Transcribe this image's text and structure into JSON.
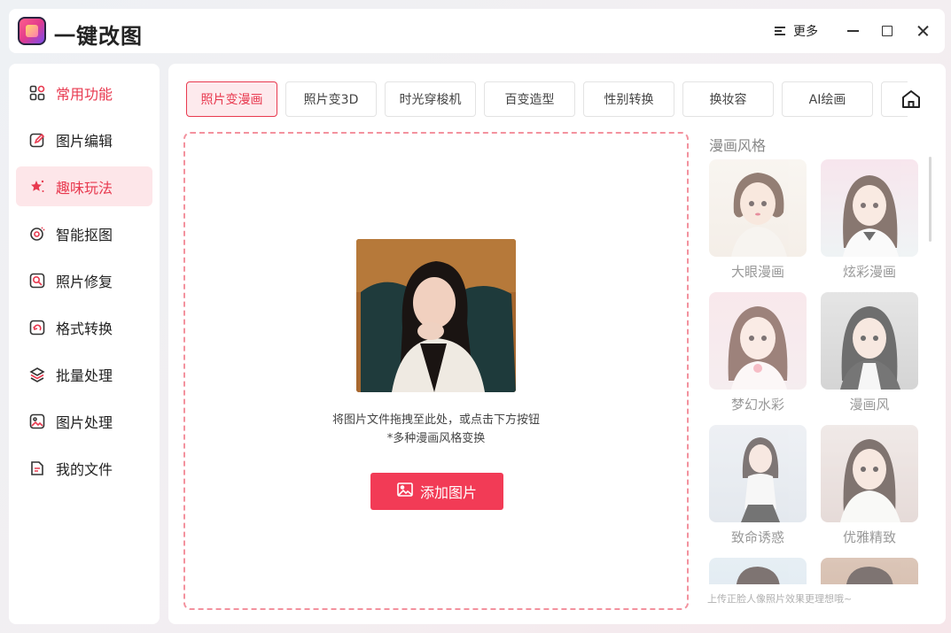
{
  "app": {
    "title": "一键改图"
  },
  "window": {
    "more_label": "更多"
  },
  "sidebar": {
    "items": [
      {
        "label": "常用功能",
        "icon": "grid-icon"
      },
      {
        "label": "图片编辑",
        "icon": "edit-icon"
      },
      {
        "label": "趣味玩法",
        "icon": "star-sparkle-icon"
      },
      {
        "label": "智能抠图",
        "icon": "cutout-icon"
      },
      {
        "label": "照片修复",
        "icon": "repair-icon"
      },
      {
        "label": "格式转换",
        "icon": "convert-icon"
      },
      {
        "label": "批量处理",
        "icon": "layers-icon"
      },
      {
        "label": "图片处理",
        "icon": "image-icon"
      },
      {
        "label": "我的文件",
        "icon": "file-icon"
      }
    ],
    "active_index": 2
  },
  "tabs": {
    "items": [
      "照片变漫画",
      "照片变3D",
      "时光穿梭机",
      "百变造型",
      "性别转换",
      "换妆容",
      "AI绘画",
      ""
    ],
    "active_index": 0
  },
  "upload": {
    "hint_line1": "将图片文件拖拽至此处，或点击下方按钮",
    "hint_line2": "*多种漫画风格变换",
    "button_label": "添加图片"
  },
  "styles": {
    "title": "漫画风格",
    "items": [
      "大眼漫画",
      "炫彩漫画",
      "梦幻水彩",
      "漫画风",
      "致命诱惑",
      "优雅精致",
      "",
      ""
    ],
    "footer_note": "上传正脸人像照片效果更理想哦~"
  },
  "colors": {
    "accent": "#e8394f",
    "button": "#f23b56",
    "dropzone_border": "#f3929e",
    "active_bg": "#fde6e9"
  }
}
